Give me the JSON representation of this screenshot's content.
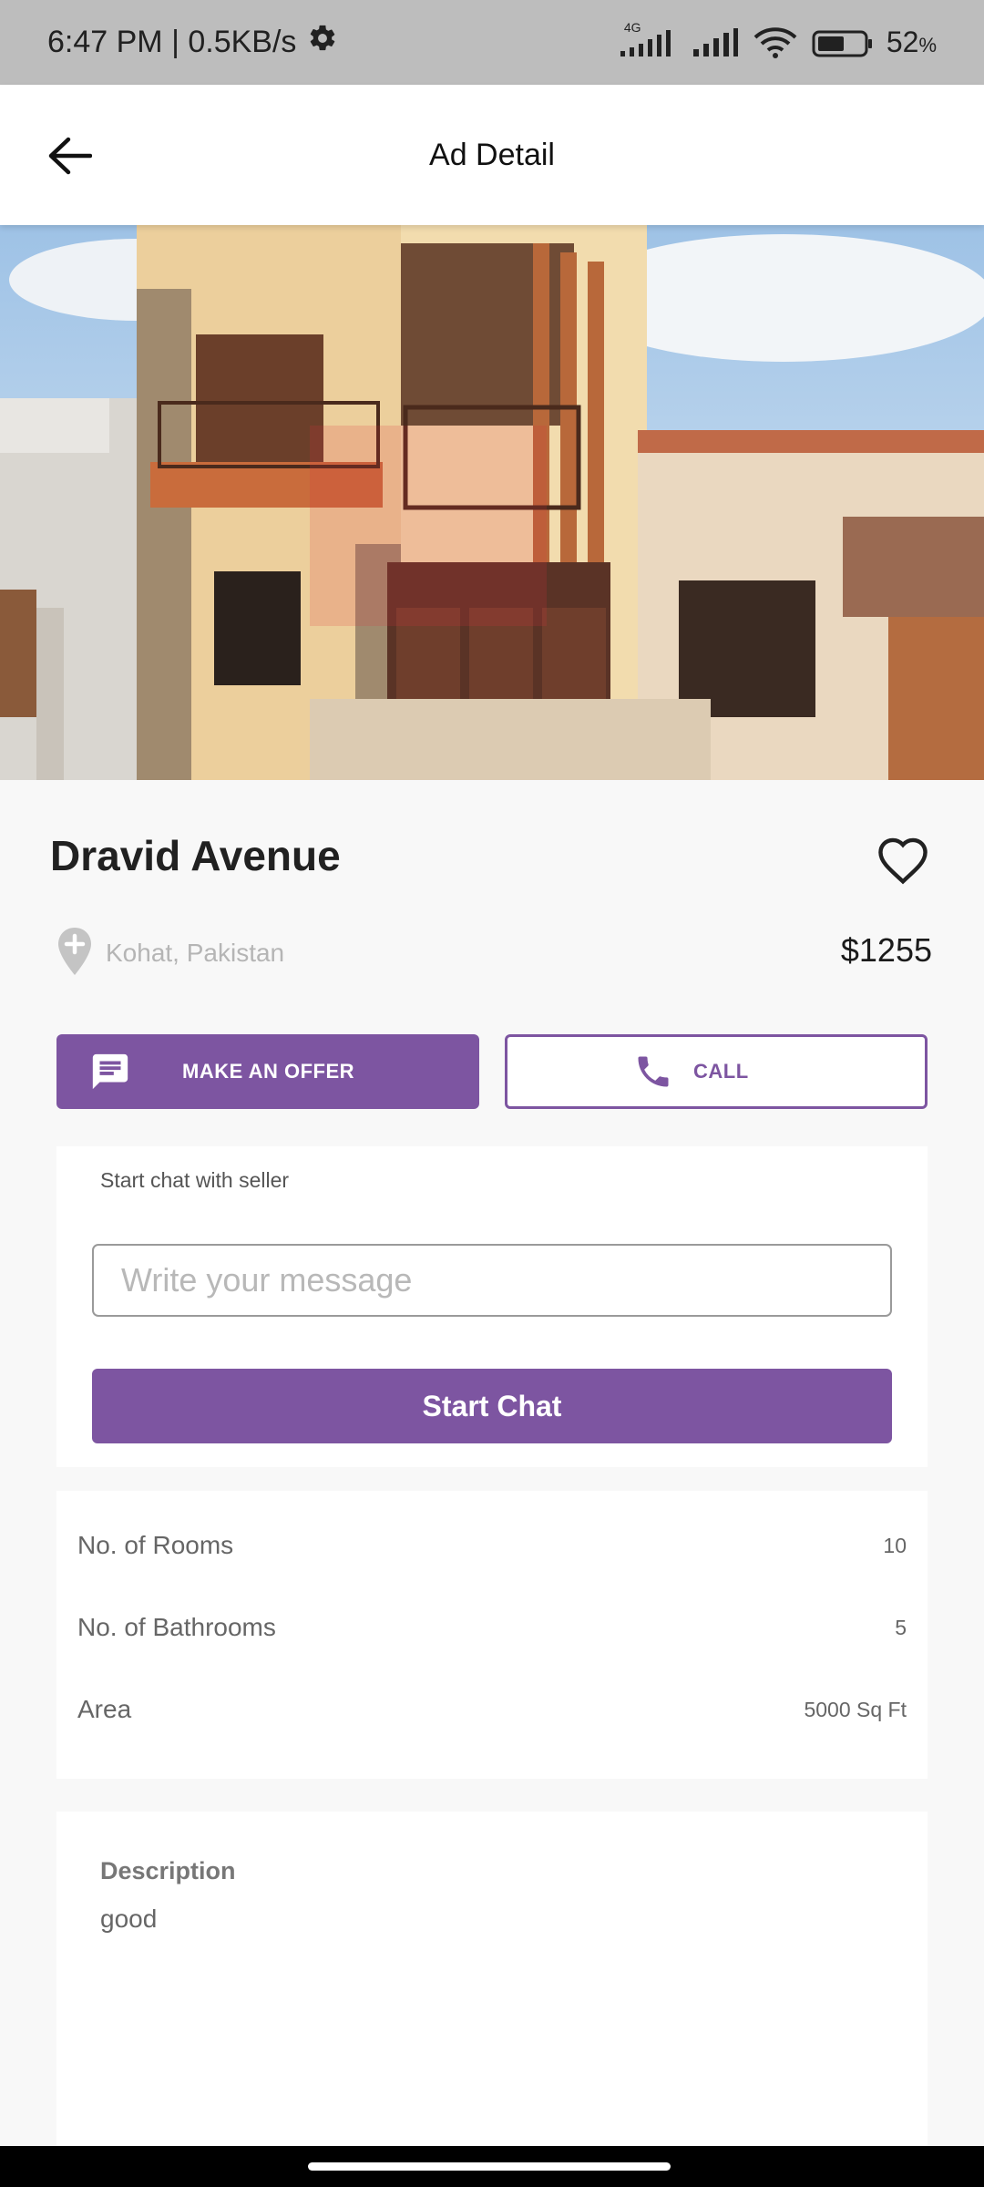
{
  "status_bar": {
    "time_speed": "6:47 PM | 0.5KB/s",
    "network_type": "4G",
    "battery_percent": "52",
    "battery_unit": "%",
    "icons": [
      "gear-icon",
      "signal-icon",
      "wifi-icon",
      "battery-icon"
    ]
  },
  "app_bar": {
    "title": "Ad Detail",
    "back_icon": "arrow-left-icon"
  },
  "listing": {
    "title": "Dravid Avenue",
    "location": "Kohat, Pakistan",
    "price": "$1255",
    "favorite_icon": "heart-outline-icon",
    "location_icon": "map-pin-plus-icon"
  },
  "actions": {
    "offer_label": "MAKE AN OFFER",
    "offer_icon": "message-icon",
    "call_label": "CALL",
    "call_icon": "phone-icon"
  },
  "chat": {
    "label": "Start chat with seller",
    "placeholder": "Write your message",
    "button_label": "Start Chat"
  },
  "specs": [
    {
      "label": "No. of Rooms",
      "value": "10"
    },
    {
      "label": "No. of Bathrooms",
      "value": "5"
    },
    {
      "label": "Area",
      "value": "5000 Sq Ft"
    }
  ],
  "description": {
    "heading": "Description",
    "text": "good"
  },
  "colors": {
    "accent": "#7d55a1",
    "status_bar": "#bdbdbd",
    "background": "#f8f8f8",
    "card": "#ffffff"
  }
}
